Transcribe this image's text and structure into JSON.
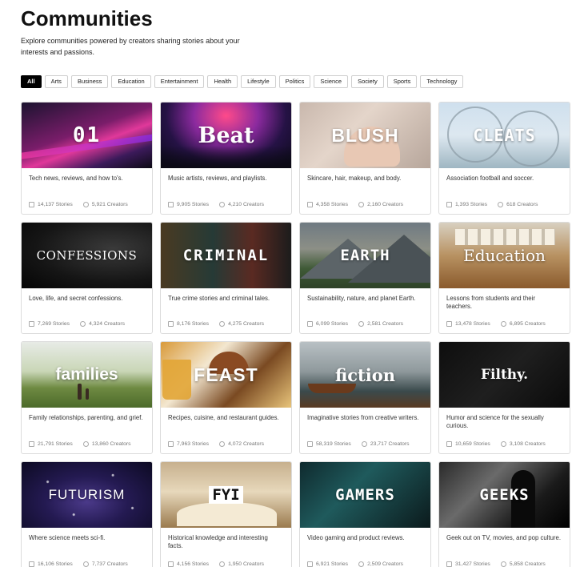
{
  "header": {
    "title": "Communities",
    "subtitle": "Explore communities powered by creators sharing stories about your interests and passions."
  },
  "filters": [
    "All",
    "Arts",
    "Business",
    "Education",
    "Entertainment",
    "Health",
    "Lifestyle",
    "Politics",
    "Science",
    "Society",
    "Sports",
    "Technology"
  ],
  "active_filter": "All",
  "communities": [
    {
      "title": "01",
      "description": "Tech news, reviews, and how to's.",
      "stories": "14,137 Stories",
      "creators": "5,921 Creators"
    },
    {
      "title": "Beat",
      "description": "Music artists, reviews, and playlists.",
      "stories": "9,905 Stories",
      "creators": "4,210 Creators"
    },
    {
      "title": "BLUSH",
      "description": "Skincare, hair, makeup, and body.",
      "stories": "4,358 Stories",
      "creators": "2,160 Creators"
    },
    {
      "title": "CLEATS",
      "description": "Association football and soccer.",
      "stories": "1,393 Stories",
      "creators": "618 Creators"
    },
    {
      "title": "CONFESSIONS",
      "description": "Love, life, and secret confessions.",
      "stories": "7,269 Stories",
      "creators": "4,324 Creators"
    },
    {
      "title": "CRIMINAL",
      "description": "True crime stories and criminal tales.",
      "stories": "8,176 Stories",
      "creators": "4,275 Creators"
    },
    {
      "title": "EARTH",
      "description": "Sustainability, nature, and planet Earth.",
      "stories": "6,099 Stories",
      "creators": "2,581 Creators"
    },
    {
      "title": "Education",
      "description": "Lessons from students and their teachers.",
      "stories": "13,478 Stories",
      "creators": "6,895 Creators"
    },
    {
      "title": "families",
      "description": "Family relationships, parenting, and grief.",
      "stories": "21,791 Stories",
      "creators": "13,860 Creators"
    },
    {
      "title": "FEAST",
      "description": "Recipes, cuisine, and restaurant guides.",
      "stories": "7,963 Stories",
      "creators": "4,072 Creators"
    },
    {
      "title": "fiction",
      "description": "Imaginative stories from creative writers.",
      "stories": "58,319 Stories",
      "creators": "23,717 Creators"
    },
    {
      "title": "Filthy.",
      "description": "Humor and science for the sexually curious.",
      "stories": "10,659 Stories",
      "creators": "3,108 Creators"
    },
    {
      "title": "FUTURISM",
      "description": "Where science meets sci-fi.",
      "stories": "16,106 Stories",
      "creators": "7,737 Creators"
    },
    {
      "title": "FYI",
      "description": "Historical knowledge and interesting facts.",
      "stories": "4,156 Stories",
      "creators": "1,950 Creators"
    },
    {
      "title": "GAMERS",
      "description": "Video gaming and product reviews.",
      "stories": "6,921 Stories",
      "creators": "2,509 Creators"
    },
    {
      "title": "GEEKS",
      "description": "Geek out on TV, movies, and pop culture.",
      "stories": "31,427 Stories",
      "creators": "5,858 Creators"
    }
  ]
}
